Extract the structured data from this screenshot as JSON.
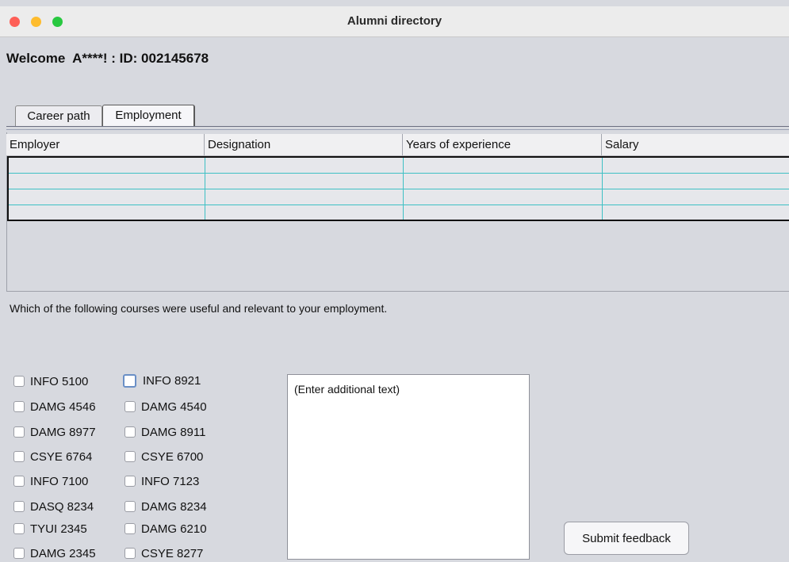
{
  "window": {
    "title": "Alumni directory",
    "traffic_lights": {
      "close": "#fe5f57",
      "minimize": "#febc2e",
      "maximize": "#28c840"
    }
  },
  "header": {
    "welcome_text": "Welcome  A****! : ID: 002145678"
  },
  "tabs": [
    {
      "label": "Career path",
      "selected": false
    },
    {
      "label": "Employment",
      "selected": true
    }
  ],
  "table": {
    "columns": [
      "Employer",
      "Designation",
      "Years of experience",
      "Salary"
    ],
    "rows": [
      [
        "",
        "",
        "",
        ""
      ],
      [
        "",
        "",
        "",
        ""
      ],
      [
        "",
        "",
        "",
        ""
      ],
      [
        "",
        "",
        "",
        ""
      ]
    ]
  },
  "courses": {
    "question": "Which of the following courses were useful and relevant to your employment.",
    "column1": [
      "INFO 5100",
      "DAMG 4546",
      "DAMG 8977",
      "CSYE 6764",
      "INFO 7100",
      "DASQ 8234",
      "TYUI 2345",
      "DAMG 2345"
    ],
    "column2": [
      "INFO 8921",
      "DAMG 4540",
      "DAMG 8911",
      "CSYE 6700",
      "INFO 7123",
      "DAMG 8234",
      "DAMG 6210",
      "CSYE 8277"
    ],
    "checked": []
  },
  "feedback": {
    "placeholder": "(Enter additional text)",
    "submit_label": "Submit feedback"
  }
}
